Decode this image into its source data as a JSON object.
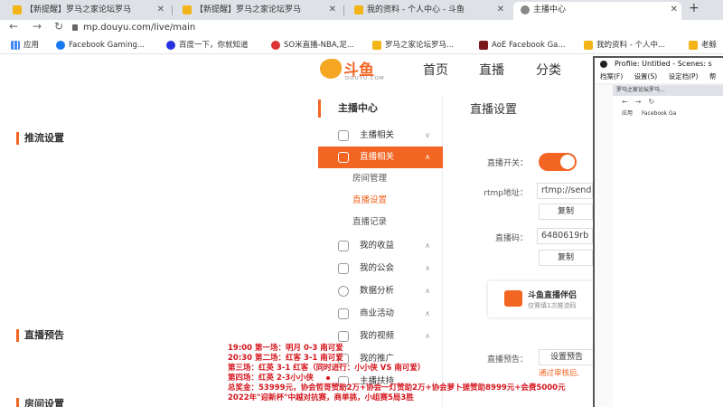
{
  "browser": {
    "tabs": [
      {
        "label": "【新提醒】罗马之家论坛罗马",
        "icon": "douyu-tab-icon"
      },
      {
        "label": "【新提醒】罗马之家论坛罗马",
        "icon": "douyu-tab-icon"
      },
      {
        "label": "我的资料 - 个人中心 - 斗鱼",
        "icon": "douyu-tab-icon"
      },
      {
        "label": "主播中心",
        "icon": "globe-icon"
      }
    ],
    "new_tab_label": "+",
    "url": "mp.douyu.com/live/main",
    "bookmarks": [
      {
        "label": "应用",
        "icon": "apps-grid-icon"
      },
      {
        "label": "Facebook Gaming...",
        "icon": "facebook-icon"
      },
      {
        "label": "百度一下，你就知道",
        "icon": "baidu-icon"
      },
      {
        "label": "SO米直播-NBA,足...",
        "icon": "so-icon"
      },
      {
        "label": "罗马之家论坛罗马...",
        "icon": "douyu-icon"
      },
      {
        "label": "AoE Facebook Ga...",
        "icon": "aoe-icon"
      },
      {
        "label": "我的资料 - 个人中...",
        "icon": "douyu-icon"
      },
      {
        "label": "老鲸",
        "icon": "douyu-icon"
      }
    ]
  },
  "header": {
    "logo_text": "斗鱼",
    "logo_sub": "DOUYU.COM",
    "nav": [
      "首页",
      "直播",
      "分类"
    ]
  },
  "sidebar": {
    "title": "主播中心",
    "items": [
      {
        "label": "主播相关",
        "icon": "mic-icon",
        "chevron": "∨"
      },
      {
        "label": "直播相关",
        "icon": "tv-icon",
        "chevron": "∧"
      },
      {
        "label": "我的收益",
        "icon": "coin-icon",
        "chevron": "∧"
      },
      {
        "label": "我的公会",
        "icon": "guild-icon",
        "chevron": "∧"
      },
      {
        "label": "数据分析",
        "icon": "pie-chart-icon",
        "chevron": "∧"
      },
      {
        "label": "商业活动",
        "icon": "briefcase-icon",
        "chevron": "∧"
      },
      {
        "label": "我的视频",
        "icon": "video-icon",
        "chevron": "∧"
      },
      {
        "label": "我的推广",
        "icon": "promo-icon",
        "chevron": ""
      },
      {
        "label": "主播扶持",
        "icon": "support-icon",
        "chevron": ""
      }
    ],
    "subitems": [
      "房间管理",
      "直播设置",
      "直播记录"
    ]
  },
  "main": {
    "title": "直播设置",
    "section_stream": "推流设置",
    "label_switch": "直播开关：",
    "label_rtmp": "rtmp地址：",
    "rtmp_value": "rtmp://send",
    "copy_label": "复制",
    "label_code": "直播码：",
    "code_value": "6480619rb",
    "promo_title": "斗鱼直播伴侣",
    "promo_sub": "仅需填1次推流码",
    "section_preview": "直播预告",
    "label_preview": "直播预告：",
    "preview_button": "设置预告",
    "review_link": "通过审核后,",
    "section_next": "房间设置"
  },
  "obs": {
    "title": "Profile: Untitled - Scenes: s",
    "menu": [
      "档案(F)",
      "设置(S)",
      "设定档(P)",
      "帮"
    ],
    "preview_tab": "罗马之家论坛罗马...",
    "preview_bm_apps": "应用",
    "preview_bm_fb": "Facebook Ga"
  },
  "watermark": "斗鱼",
  "overlay": {
    "lines": [
      "19:00 第一场：明月 0-3 南可爱",
      "20:30 第二场：红客 3-1 南可爱",
      "第三场：红英 3-1 红客（同时进行：小小侠 VS 南可爱）",
      "第四场：红英 2-3小小侠",
      "总奖金：53999元，协会哲哥赞助2万+协会一灯赞助2万+协会萝卜搓赞助8999元+会费5000元",
      "2022年\"迎新杯\"中越对抗赛，商单挑，小组赛5局3胜"
    ]
  },
  "colors": {
    "brand": "#f26522",
    "overlay_text": "#d4141c"
  }
}
